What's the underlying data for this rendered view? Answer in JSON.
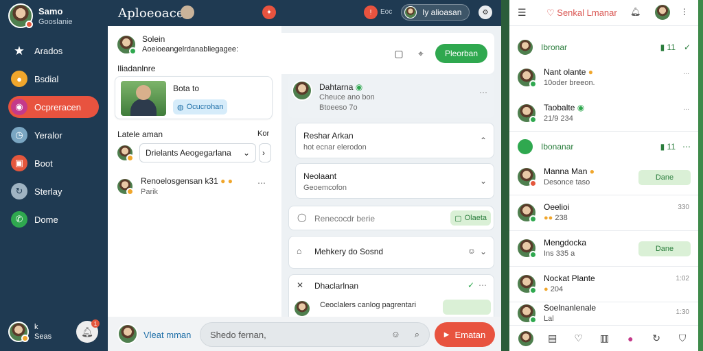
{
  "sidebar": {
    "profile": {
      "name": "Samo",
      "subtitle": "Gooslanie"
    },
    "items": [
      {
        "label": "Arados",
        "icon": "star-icon",
        "color": "#ffffff"
      },
      {
        "label": "Bsdial",
        "icon": "chat-bubble-icon",
        "color": "#f0a62c"
      },
      {
        "label": "Ocpreracen",
        "icon": "circle-icon",
        "color": "#e8533f"
      },
      {
        "label": "Yeralor",
        "icon": "clock-icon",
        "color": "#7aa6c2"
      },
      {
        "label": "Boot",
        "icon": "box-icon",
        "color": "#e4573d"
      },
      {
        "label": "Sterlay",
        "icon": "loop-icon",
        "color": "#9fb3c2"
      },
      {
        "label": "Dome",
        "icon": "phone-icon",
        "color": "#2fa84f"
      }
    ],
    "bottom": {
      "name": "k",
      "subtitle": "Seas",
      "bell_badge": "1"
    }
  },
  "topbar": {
    "title": "Aploeoacer",
    "chip_label": "Iy alioasan"
  },
  "left_panel": {
    "header_name": "Solein",
    "header_text": "Aoeioeangelrdanabliegagee:",
    "section_label": "Iliadanlnre",
    "card": {
      "title": "Bota to",
      "pill": "Ocucrohan"
    },
    "latest_label": "Latele aman",
    "latest_action": "Kor",
    "select_value": "Drielants Aeogegarlana",
    "chat_name": "Renoelosgensan k31",
    "chat_sub": "Parik"
  },
  "mid_panel": {
    "primary_button": "Pleorban",
    "message": {
      "name": "Dahtarna",
      "line1": "Cheuce ano bon",
      "line2": "Btoeeso 7o"
    },
    "box1": {
      "title": "Reshar Arkan",
      "sub": "hot ecnar elerodon"
    },
    "box2": {
      "title": "Neolaant",
      "sub": "Geoemcofon"
    },
    "box3": {
      "placeholder": "Renecocdr berie",
      "button": "Olaeta"
    },
    "box4": {
      "title": "Mehkery do Sosnd"
    },
    "box5": {
      "title": "Dhaclarlnan",
      "sub": "Ceoclalers canlog pagrentari"
    }
  },
  "composer": {
    "user": "Vleat mman",
    "placeholder": "Shedo fernan,",
    "send_label": "Ematan"
  },
  "right_panel": {
    "brand": "Senkal Lmanar",
    "groups": [
      {
        "name": "Ibronar",
        "count": "11"
      },
      {
        "name": "Ibonanar",
        "count": "11"
      }
    ],
    "contacts": [
      {
        "name": "Nant olante",
        "status": "10oder breeon.",
        "meta": "..."
      },
      {
        "name": "Taobalte",
        "status": "21/9 234",
        "meta": "..."
      },
      {
        "name": "Manna Man",
        "status": "Desonce taso",
        "tag": "Dane"
      },
      {
        "name": "Oeelioi",
        "status": "238",
        "meta": "330"
      },
      {
        "name": "Mengdocka",
        "status": "Ins 335 a",
        "tag": "Dane"
      },
      {
        "name": "Nockat Plante",
        "status": "204",
        "meta": "1:02"
      },
      {
        "name": "Soelnanlenale",
        "status": "Lal",
        "meta": "1:30"
      }
    ]
  }
}
